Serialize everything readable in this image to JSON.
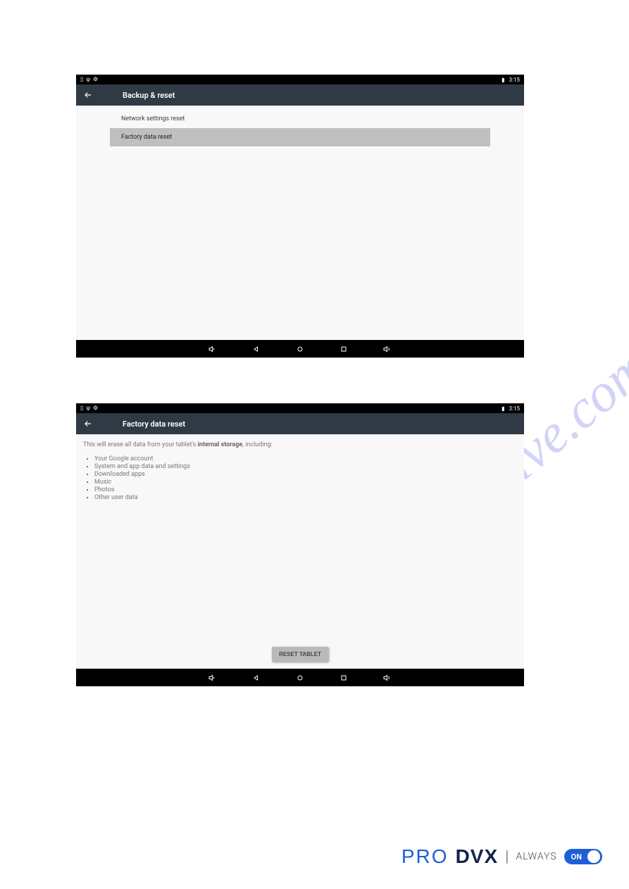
{
  "status_bar": {
    "time": "3:15"
  },
  "screenshot1": {
    "title": "Backup & reset",
    "list": {
      "item1": "Network settings reset",
      "item2": "Factory data reset"
    }
  },
  "screenshot2": {
    "title": "Factory data reset",
    "intro_pre": "This will erase all data from your tablet's ",
    "intro_bold": "internal storage",
    "intro_post": ", including:",
    "bullets": {
      "b1": "Your Google account",
      "b2": "System and app data and settings",
      "b3": "Downloaded apps",
      "b4": "Music",
      "b5": "Photos",
      "b6": "Other user data"
    },
    "reset_button": "RESET TABLET"
  },
  "watermark": "manualshive.com",
  "footer": {
    "pro": "PRO",
    "dvx": "DVX",
    "always": "ALWAYS",
    "on": "ON"
  }
}
